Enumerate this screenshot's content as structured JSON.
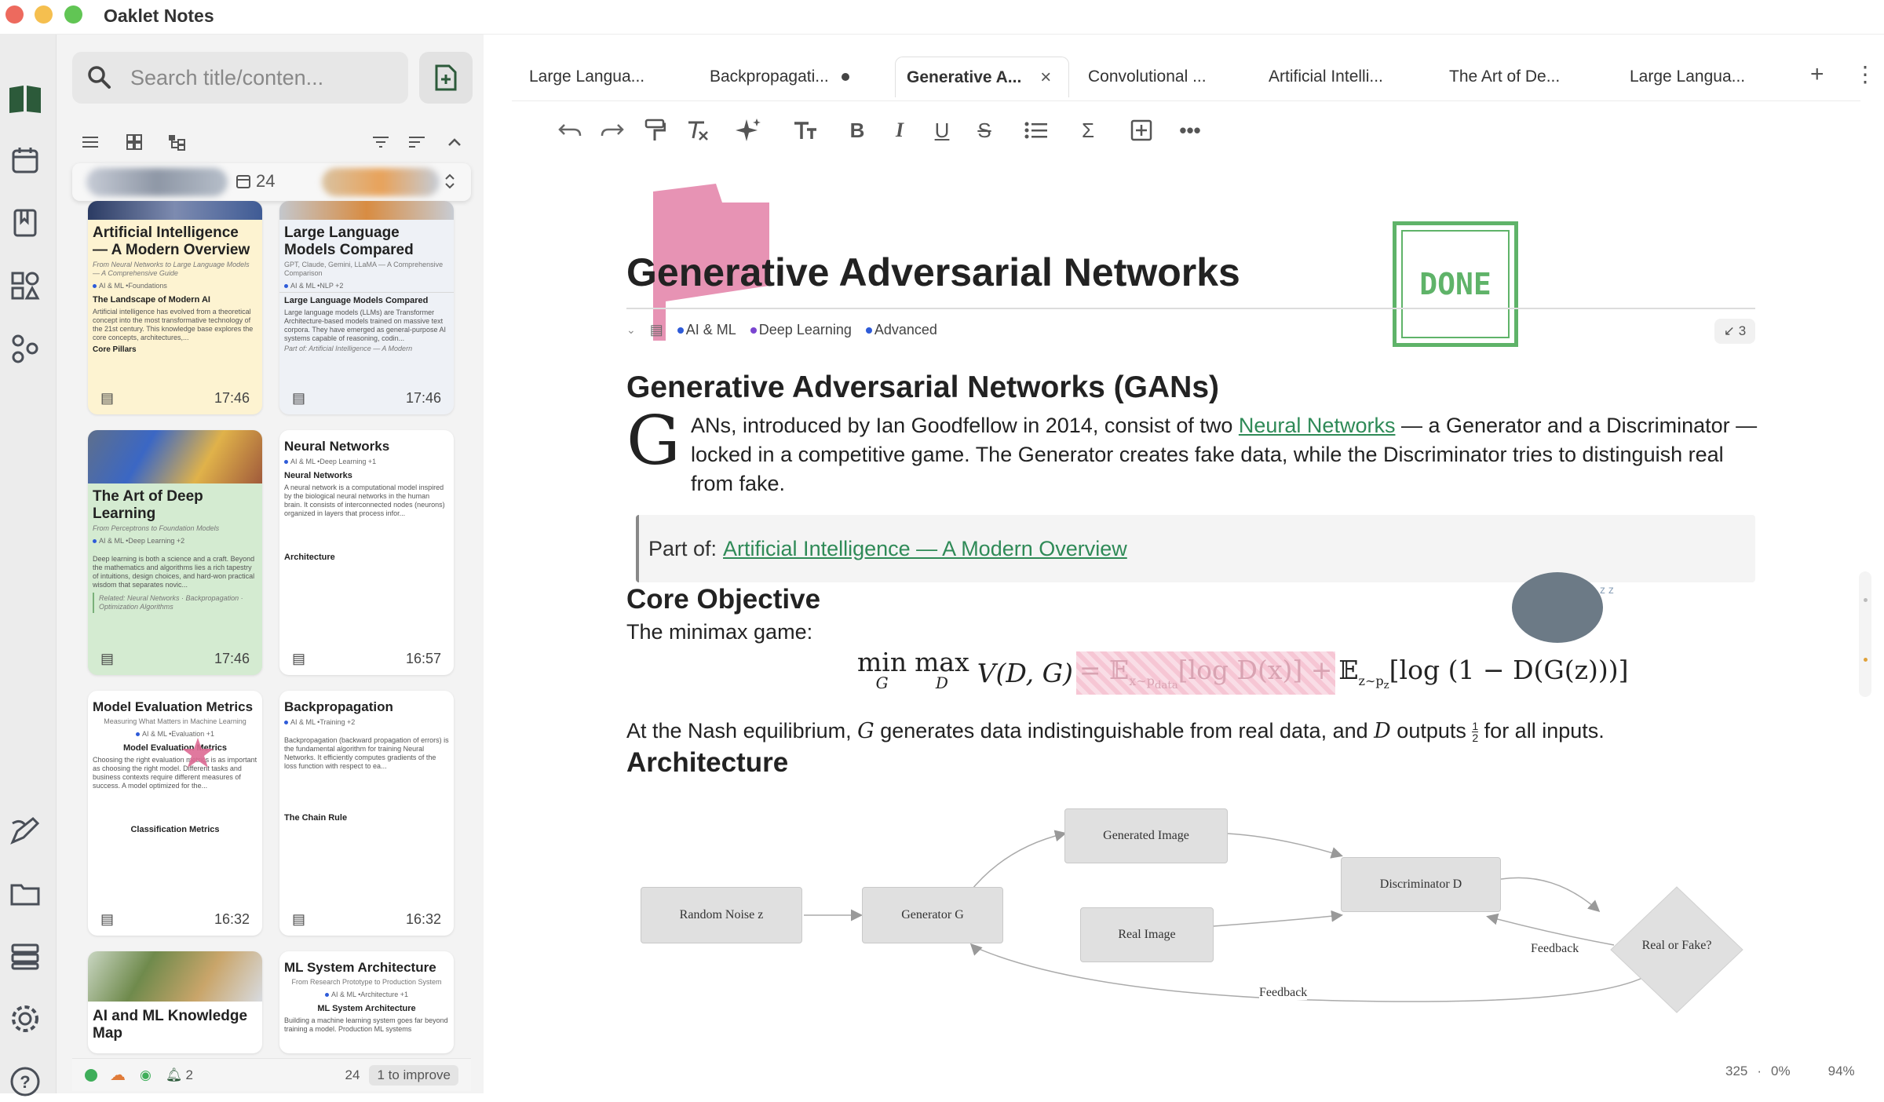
{
  "app": {
    "title": "Oaklet Notes"
  },
  "colors": {
    "accent": "#2f8a57",
    "tag_dot": "#2e5bd8",
    "done_stamp": "#5fb369",
    "flag": "#e0608e"
  },
  "activity_bar": {
    "icons": [
      "book-icon",
      "calendar-icon",
      "bookmark-icon",
      "shapes-icon",
      "graph-icon",
      "pen-icon",
      "folder-icon",
      "layers-icon",
      "gear-icon",
      "help-icon"
    ]
  },
  "sidebar": {
    "search": {
      "placeholder": "Search title/conten..."
    },
    "date_count": "24",
    "cards": [
      {
        "title": "Artificial Intelligence — A Modern Overview",
        "subtitle": "From Neural Networks to Large Language Models — A Comprehensive Guide",
        "tags": "AI & ML  •Foundations",
        "section": "The Landscape of Modern AI",
        "body": "Artificial intelligence has evolved from a theoretical concept into the most transformative technology of the 21st century. This knowledge base explores the core concepts, architectures,...",
        "extra": "Core Pillars",
        "time": "17:46"
      },
      {
        "title": "Large Language Models Compared",
        "subtitle": "GPT, Claude, Gemini, LLaMA — A Comprehensive Comparison",
        "tags": "AI & ML  •NLP  +2",
        "section": "Large Language Models Compared",
        "body": "Large language models (LLMs) are Transformer Architecture-based models trained on massive text corpora. They have emerged as general-purpose AI systems capable of reasoning, codin...",
        "extra": "Part of: Artificial Intelligence — A Modern",
        "time": "17:46"
      },
      {
        "title": "The Art of Deep Learning",
        "subtitle": "From Perceptrons to Foundation Models",
        "tags": "AI & ML  •Deep Learning  +2",
        "section": "",
        "body": "Deep learning is both a science and a craft. Beyond the mathematics and algorithms lies a rich tapestry of intuitions, design choices, and hard-won practical wisdom that separates novic...",
        "extra": "Related: Neural Networks · Backpropagation · Optimization Algorithms",
        "time": "17:46"
      },
      {
        "title": "Neural Networks",
        "subtitle": "",
        "tags": "AI & ML  •Deep Learning  +1",
        "section": "Neural Networks",
        "body": "A neural network is a computational model inspired by the biological neural networks in the human brain. It consists of interconnected nodes (neurons) organized in layers that process infor...",
        "extra": "Architecture",
        "time": "16:57"
      },
      {
        "title": "Model Evaluation Metrics",
        "subtitle": "Measuring What Matters in Machine Learning",
        "tags": "AI & ML  •Evaluation  +1",
        "section": "Model Evaluation Metrics",
        "body": "Choosing the right evaluation metrics is as important as choosing the right model. Different tasks and business contexts require different measures of success. A model optimized for the...",
        "extra": "Classification Metrics",
        "time": "16:32"
      },
      {
        "title": "Backpropagation",
        "subtitle": "",
        "tags": "AI & ML  •Training  +2",
        "section": "",
        "body": "Backpropagation (backward propagation of errors) is the fundamental algorithm for training Neural Networks. It efficiently computes gradients of the loss function with respect to ea...",
        "extra": "The Chain Rule",
        "time": "16:32"
      },
      {
        "title": "AI and ML Knowledge Map",
        "subtitle": "",
        "tags": "",
        "section": "",
        "body": "",
        "extra": "",
        "time": ""
      },
      {
        "title": "ML System Architecture",
        "subtitle": "From Research Prototype to Production System",
        "tags": "AI & ML  •Architecture  +1",
        "section": "ML System Architecture",
        "body": "Building a machine learning system goes far beyond training a model. Production ML systems",
        "extra": "",
        "time": ""
      }
    ],
    "status": {
      "badge_count": "2",
      "note_count": "24",
      "improve_label": "1 to improve"
    }
  },
  "tabs": [
    {
      "label": "Large Langua...",
      "active": false
    },
    {
      "label": "Backpropagati...",
      "active": false,
      "modified": true
    },
    {
      "label": "Generative A...",
      "active": true
    },
    {
      "label": "Convolutional ...",
      "active": false
    },
    {
      "label": "Artificial Intelli...",
      "active": false
    },
    {
      "label": "The Art of De...",
      "active": false
    },
    {
      "label": "Large Langua...",
      "active": false
    }
  ],
  "toolbar": {
    "icons": [
      "undo-icon",
      "redo-icon",
      "format-painter-icon",
      "clear-format-icon",
      "ai-sparkle-icon",
      "text-size-icon",
      "bold-icon",
      "italic-icon",
      "underline-icon",
      "strikethrough-icon",
      "bullet-list-icon",
      "sigma-icon",
      "insert-block-icon",
      "more-icon"
    ]
  },
  "doc": {
    "title": "Generative Adversarial Networks",
    "stamp": "DONE",
    "tags": [
      "AI & ML",
      "Deep Learning",
      "Advanced"
    ],
    "backlinks": "3",
    "h1": "Generative Adversarial Networks (GANs)",
    "dropcap": "G",
    "intro_a": "ANs, introduced by Ian Goodfellow in 2014, consist of two ",
    "intro_link": "Neural Networks",
    "intro_b": " — a Generator and a Discriminator — locked in a competitive game. The Generator creates fake data, while the Discriminator tries to distinguish real from fake.",
    "partof_label": "Part of:",
    "partof_link": "Artificial Intelligence — A Modern Overview",
    "h2_objective": "Core Objective",
    "minimax_label": "The minimax game:",
    "nash_a": "At the Nash equilibrium, ",
    "nash_g": "G",
    "nash_b": " generates data indistinguishable from real data, and ",
    "nash_d": "D",
    "nash_c": " outputs ",
    "nash_e": " for all inputs.",
    "h2_architecture": "Architecture",
    "diagram": {
      "nodes": [
        "Random Noise z",
        "Generator G",
        "Generated Image",
        "Real Image",
        "Discriminator D",
        "Real or Fake?"
      ],
      "edge_labels": [
        "Feedback",
        "Feedback"
      ]
    },
    "footer": {
      "words": "325",
      "progress": "0%",
      "zoom": "94%"
    }
  }
}
